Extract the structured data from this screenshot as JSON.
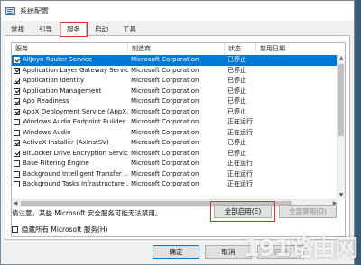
{
  "window": {
    "title": "系统配置"
  },
  "tabs": [
    {
      "label": "常规"
    },
    {
      "label": "引导"
    },
    {
      "label": "服务"
    },
    {
      "label": "启动"
    },
    {
      "label": "工具"
    }
  ],
  "table": {
    "headers": [
      "服务",
      "制造商",
      "状态",
      "禁用日期"
    ],
    "rows": [
      {
        "service": "AllJoyn Router Service",
        "manufacturer": "Microsoft Corporation",
        "status": "已停止",
        "disabled_date": "",
        "checked": true,
        "selected": true
      },
      {
        "service": "Application Layer Gateway Service",
        "manufacturer": "Microsoft Corporation",
        "status": "已停止",
        "disabled_date": "",
        "checked": true,
        "selected": false
      },
      {
        "service": "Application Identity",
        "manufacturer": "Microsoft Corporation",
        "status": "已停止",
        "disabled_date": "",
        "checked": true,
        "selected": false
      },
      {
        "service": "Application Management",
        "manufacturer": "Microsoft Corporation",
        "status": "已停止",
        "disabled_date": "",
        "checked": true,
        "selected": false
      },
      {
        "service": "App Readiness",
        "manufacturer": "Microsoft Corporation",
        "status": "已停止",
        "disabled_date": "",
        "checked": true,
        "selected": false
      },
      {
        "service": "AppX Deployment Service (AppX...",
        "manufacturer": "Microsoft Corporation",
        "status": "已停止",
        "disabled_date": "",
        "checked": true,
        "selected": false
      },
      {
        "service": "Windows Audio Endpoint Builder",
        "manufacturer": "Microsoft Corporation",
        "status": "正在运行",
        "disabled_date": "",
        "checked": false,
        "selected": false
      },
      {
        "service": "Windows Audio",
        "manufacturer": "Microsoft Corporation",
        "status": "正在运行",
        "disabled_date": "",
        "checked": false,
        "selected": false
      },
      {
        "service": "ActiveX Installer (AxInstSV)",
        "manufacturer": "Microsoft Corporation",
        "status": "已停止",
        "disabled_date": "",
        "checked": true,
        "selected": false
      },
      {
        "service": "BitLocker Drive Encryption Service",
        "manufacturer": "Microsoft Corporation",
        "status": "已停止",
        "disabled_date": "",
        "checked": true,
        "selected": false
      },
      {
        "service": "Base Filtering Engine",
        "manufacturer": "Microsoft Corporation",
        "status": "正在运行",
        "disabled_date": "",
        "checked": false,
        "selected": false
      },
      {
        "service": "Background Intelligent Transfer ...",
        "manufacturer": "Microsoft Corporation",
        "status": "正在运行",
        "disabled_date": "",
        "checked": false,
        "selected": false
      },
      {
        "service": "Background Tasks Infrastructure ...",
        "manufacturer": "Microsoft Corporation",
        "status": "正在运行",
        "disabled_date": "",
        "checked": false,
        "selected": false
      }
    ]
  },
  "note": "请注意，某些 Microsoft 安全服务可能无法禁用。",
  "buttons": {
    "enable_all": "全部启用(E)",
    "disable_all": "全部禁用(D)",
    "ok": "确定",
    "cancel": "取消",
    "apply": "应用"
  },
  "hide_ms_services": {
    "label": "隐藏所有 Microsoft 服务(H)",
    "checked": false
  },
  "watermark": "191路由网",
  "colors": {
    "selection": "#0078d7",
    "highlight_box": "#e0312e"
  }
}
